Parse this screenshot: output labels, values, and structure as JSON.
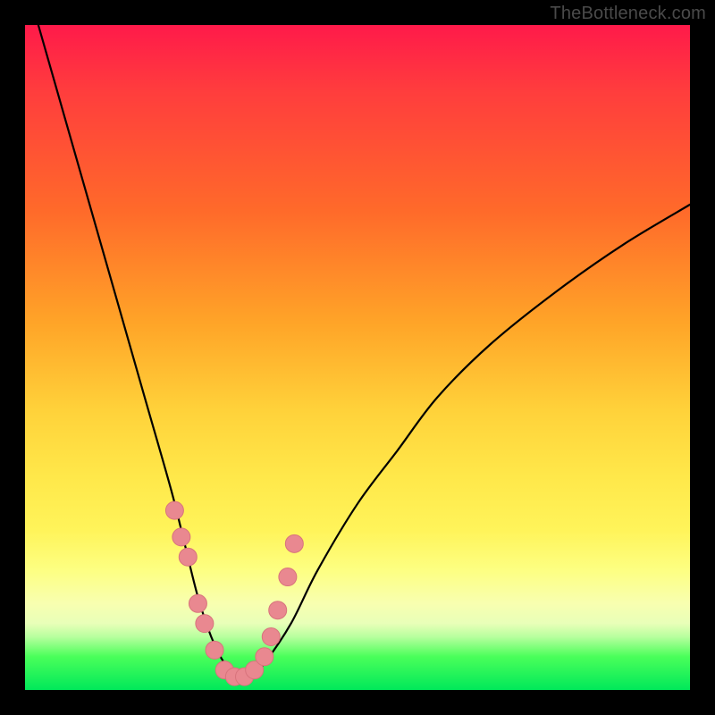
{
  "watermark": "TheBottleneck.com",
  "colors": {
    "curve_stroke": "#000000",
    "marker_fill": "#e98890",
    "marker_stroke": "#d8737c",
    "frame_bg": "#000000"
  },
  "chart_data": {
    "type": "line",
    "title": "",
    "xlabel": "",
    "ylabel": "",
    "xlim": [
      0,
      100
    ],
    "ylim": [
      0,
      100
    ],
    "series": [
      {
        "name": "bottleneck-curve",
        "x": [
          2,
          6,
          10,
          14,
          18,
          22,
          24,
          26,
          28,
          30,
          32,
          34,
          36,
          40,
          44,
          50,
          56,
          62,
          70,
          80,
          90,
          100
        ],
        "y": [
          100,
          86,
          72,
          58,
          44,
          30,
          22,
          14,
          8,
          4,
          2,
          2,
          4,
          10,
          18,
          28,
          36,
          44,
          52,
          60,
          67,
          73
        ]
      }
    ],
    "markers": {
      "name": "highlight-dots",
      "x": [
        22.5,
        23.5,
        24.5,
        26.0,
        27.0,
        28.5,
        30.0,
        31.5,
        33.0,
        34.5,
        36.0,
        37.0,
        38.0,
        39.5,
        40.5
      ],
      "y": [
        27,
        23,
        20,
        13,
        10,
        6,
        3,
        2,
        2,
        3,
        5,
        8,
        12,
        17,
        22
      ],
      "r": 10
    }
  }
}
